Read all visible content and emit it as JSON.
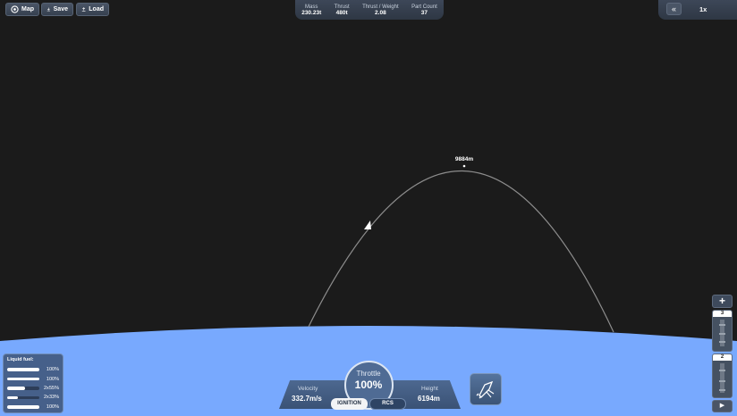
{
  "toolbar": {
    "map_label": "Map",
    "save_label": "Save",
    "load_label": "Load"
  },
  "stats": {
    "mass_label": "Mass",
    "mass_value": "230.23t",
    "thrust_label": "Thrust",
    "thrust_value": "480t",
    "tw_label": "Thrust / Weight",
    "tw_value": "2.08",
    "parts_label": "Part Count",
    "parts_value": "37"
  },
  "time": {
    "rewind_icon": "double-chevron-left-icon",
    "scale": "1x"
  },
  "trajectory": {
    "apoapsis_label": "9884m"
  },
  "fuel": {
    "title": "Liquid fuel:",
    "tanks": [
      {
        "multiplier": "",
        "percent": "100%",
        "level": 1.0
      },
      {
        "multiplier": "",
        "percent": "100%",
        "level": 1.0
      },
      {
        "multiplier": "2x",
        "percent": "55%",
        "level": 0.55
      },
      {
        "multiplier": "2x",
        "percent": "33%",
        "level": 0.33
      },
      {
        "multiplier": "",
        "percent": "100%",
        "level": 1.0
      }
    ]
  },
  "controls": {
    "throttle_label": "Throttle",
    "throttle_value": "100%",
    "velocity_label": "Velocity",
    "velocity_value": "332.7m/s",
    "height_label": "Height",
    "height_value": "6194m",
    "ignition_label": "IGNITION",
    "rcs_label": "RCS",
    "stage_icon": "rocket-separation-icon"
  },
  "staging": {
    "add_icon": "plus-icon",
    "stages": [
      "3",
      "2"
    ],
    "play_icon": "play-icon"
  },
  "colors": {
    "sky": "#1b1b1b",
    "planet": "#78a9fe",
    "ui_panel": "#3d4758",
    "ui_blue": "#4d6890"
  }
}
